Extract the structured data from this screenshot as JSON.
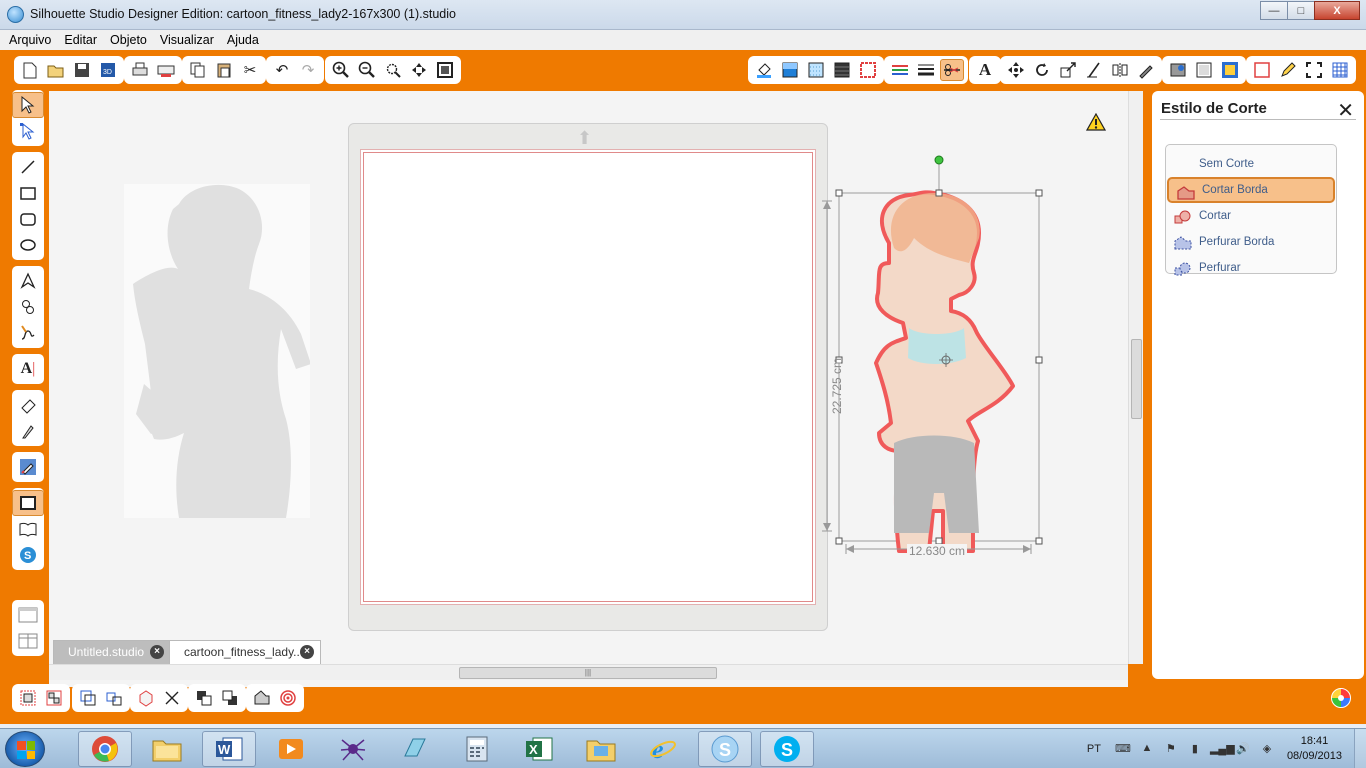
{
  "window": {
    "title": "Silhouette Studio Designer Edition: cartoon_fitness_lady2-167x300 (1).studio",
    "minimize": "—",
    "maximize": "□",
    "close": "X"
  },
  "menu": [
    "Arquivo",
    "Editar",
    "Objeto",
    "Visualizar",
    "Ajuda"
  ],
  "canvas": {
    "width_label": "12.630 cm",
    "height_label": "22.725 cm"
  },
  "tabs": [
    {
      "label": "Untitled.studio",
      "close": "×"
    },
    {
      "label": "cartoon_fitness_lady...",
      "close": "×"
    }
  ],
  "panel": {
    "title": "Estilo de Corte",
    "close": "✕",
    "options": [
      {
        "label": "Sem Corte",
        "selected": false
      },
      {
        "label": "Cortar Borda",
        "selected": true
      },
      {
        "label": "Cortar",
        "selected": false
      },
      {
        "label": "Perfurar Borda",
        "selected": false
      },
      {
        "label": "Perfurar",
        "selected": false
      }
    ]
  },
  "taskbar": {
    "language": "PT",
    "time": "18:41",
    "date": "08/09/2013"
  },
  "colors": {
    "frame": "#ef7a00",
    "cut_line": "#f05a5a",
    "selection_highlight": "#f7c08a"
  }
}
